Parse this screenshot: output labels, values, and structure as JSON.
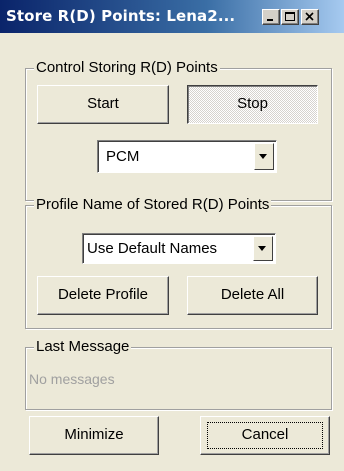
{
  "window": {
    "title": "Store R(D) Points: Lena2..."
  },
  "control": {
    "group_label": "Control Storing R(D) Points",
    "start_label": "Start",
    "stop_label": "Stop",
    "format_value": "PCM"
  },
  "profile": {
    "group_label": "Profile Name of Stored R(D) Points",
    "naming_value": "Use Default Names",
    "delete_profile_label": "Delete Profile",
    "delete_all_label": "Delete All"
  },
  "last_message": {
    "group_label": "Last Message",
    "text": "No messages"
  },
  "footer": {
    "minimize_label": "Minimize",
    "cancel_label": "Cancel"
  },
  "icons": [
    "minimize-icon",
    "maximize-icon",
    "close-icon",
    "chevron-down-icon"
  ],
  "colors": {
    "titlebar_start": "#0a246a",
    "titlebar_end": "#a6caf0",
    "window_bg": "#ece9d8",
    "disabled_text": "#a0a0a0"
  }
}
